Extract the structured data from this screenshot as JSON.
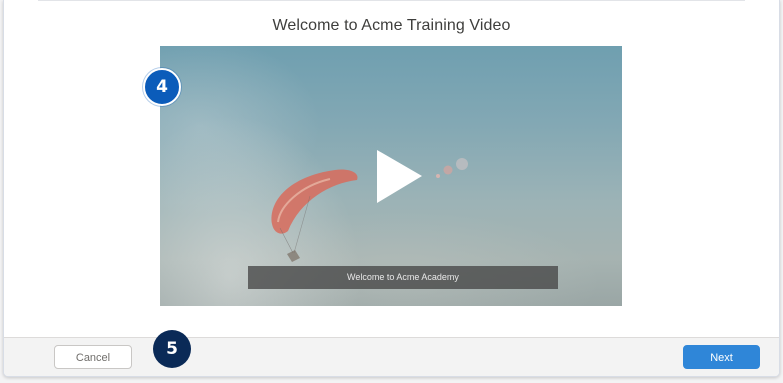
{
  "dialog": {
    "title": "Welcome to Acme Training Video"
  },
  "video": {
    "caption": "Welcome to Acme Academy",
    "play_icon": "play-icon"
  },
  "annotations": {
    "marker_video": "4",
    "marker_footer": "5"
  },
  "footer": {
    "cancel_label": "Cancel",
    "next_label": "Next"
  },
  "colors": {
    "primary": "#2f86d8",
    "marker_light": "#0b5cba",
    "marker_dark": "#0a2a57",
    "paraglider_canopy": "#d86b5c"
  }
}
